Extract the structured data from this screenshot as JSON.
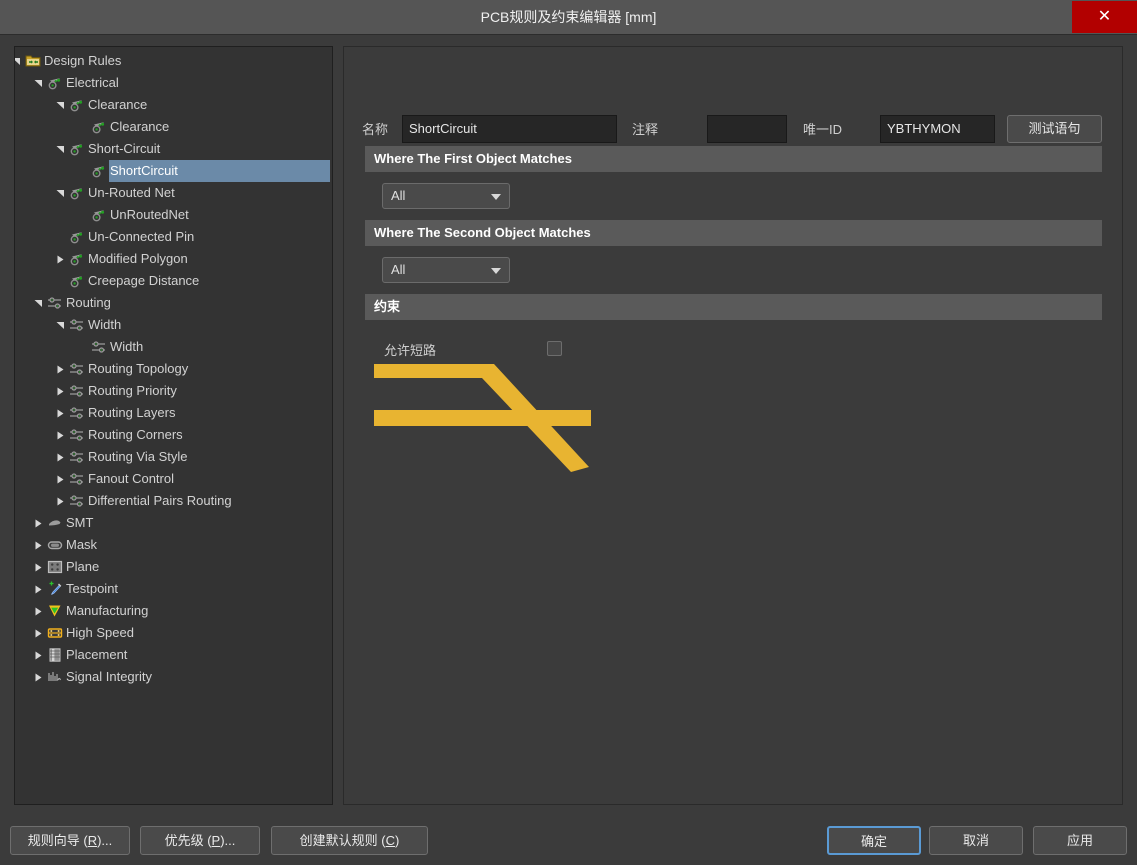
{
  "window": {
    "title": "PCB规则及约束编辑器 [mm]",
    "close_label": "✕",
    "accent_color": "#b20000",
    "selection_color": "#6b8aa8",
    "trace_color": "#e8b431"
  },
  "tree": {
    "root_label": "Design Rules",
    "items": [
      {
        "label": "Design Rules",
        "depth": 0,
        "icon": "design-rules-folder-icon",
        "arrow": "expanded",
        "selected": false
      },
      {
        "label": "Electrical",
        "depth": 1,
        "icon": "electrical-icon",
        "arrow": "expanded",
        "selected": false
      },
      {
        "label": "Clearance",
        "depth": 2,
        "icon": "electrical-icon",
        "arrow": "expanded",
        "selected": false
      },
      {
        "label": "Clearance",
        "depth": 3,
        "icon": "electrical-icon",
        "arrow": "none",
        "selected": false
      },
      {
        "label": "Short-Circuit",
        "depth": 2,
        "icon": "electrical-icon",
        "arrow": "expanded",
        "selected": false
      },
      {
        "label": "ShortCircuit",
        "depth": 3,
        "icon": "electrical-icon",
        "arrow": "none",
        "selected": true
      },
      {
        "label": "Un-Routed Net",
        "depth": 2,
        "icon": "electrical-icon",
        "arrow": "expanded",
        "selected": false
      },
      {
        "label": "UnRoutedNet",
        "depth": 3,
        "icon": "electrical-icon",
        "arrow": "none",
        "selected": false
      },
      {
        "label": "Un-Connected Pin",
        "depth": 2,
        "icon": "electrical-icon",
        "arrow": "none",
        "selected": false
      },
      {
        "label": "Modified Polygon",
        "depth": 2,
        "icon": "electrical-icon",
        "arrow": "collapsed",
        "selected": false
      },
      {
        "label": "Creepage Distance",
        "depth": 2,
        "icon": "electrical-icon",
        "arrow": "none",
        "selected": false
      },
      {
        "label": "Routing",
        "depth": 1,
        "icon": "routing-icon",
        "arrow": "expanded",
        "selected": false
      },
      {
        "label": "Width",
        "depth": 2,
        "icon": "routing-icon",
        "arrow": "expanded",
        "selected": false
      },
      {
        "label": "Width",
        "depth": 3,
        "icon": "routing-icon",
        "arrow": "none",
        "selected": false
      },
      {
        "label": "Routing Topology",
        "depth": 2,
        "icon": "routing-icon",
        "arrow": "collapsed",
        "selected": false
      },
      {
        "label": "Routing Priority",
        "depth": 2,
        "icon": "routing-icon",
        "arrow": "collapsed",
        "selected": false
      },
      {
        "label": "Routing Layers",
        "depth": 2,
        "icon": "routing-icon",
        "arrow": "collapsed",
        "selected": false
      },
      {
        "label": "Routing Corners",
        "depth": 2,
        "icon": "routing-icon",
        "arrow": "collapsed",
        "selected": false
      },
      {
        "label": "Routing Via Style",
        "depth": 2,
        "icon": "routing-icon",
        "arrow": "collapsed",
        "selected": false
      },
      {
        "label": "Fanout Control",
        "depth": 2,
        "icon": "routing-icon",
        "arrow": "collapsed",
        "selected": false
      },
      {
        "label": "Differential Pairs Routing",
        "depth": 2,
        "icon": "routing-icon",
        "arrow": "collapsed",
        "selected": false
      },
      {
        "label": "SMT",
        "depth": 1,
        "icon": "smt-icon",
        "arrow": "collapsed",
        "selected": false
      },
      {
        "label": "Mask",
        "depth": 1,
        "icon": "mask-icon",
        "arrow": "collapsed",
        "selected": false
      },
      {
        "label": "Plane",
        "depth": 1,
        "icon": "plane-icon",
        "arrow": "collapsed",
        "selected": false
      },
      {
        "label": "Testpoint",
        "depth": 1,
        "icon": "testpoint-icon",
        "arrow": "collapsed",
        "selected": false
      },
      {
        "label": "Manufacturing",
        "depth": 1,
        "icon": "manufacturing-icon",
        "arrow": "collapsed",
        "selected": false
      },
      {
        "label": "High Speed",
        "depth": 1,
        "icon": "high-speed-icon",
        "arrow": "collapsed",
        "selected": false
      },
      {
        "label": "Placement",
        "depth": 1,
        "icon": "placement-icon",
        "arrow": "collapsed",
        "selected": false
      },
      {
        "label": "Signal Integrity",
        "depth": 1,
        "icon": "signal-integrity-icon",
        "arrow": "collapsed",
        "selected": false
      }
    ]
  },
  "rule_form": {
    "name_label": "名称",
    "name_value": "ShortCircuit",
    "comment_label": "注释",
    "comment_value": "",
    "unique_id_label": "唯一ID",
    "unique_id_value": "YBTHYMON",
    "test_query_label": "测试语句",
    "first_object_header": "Where The First Object Matches",
    "first_object_scope": "All",
    "second_object_header": "Where The Second Object Matches",
    "second_object_scope": "All",
    "constraints_header": "约束",
    "allow_short_circuit_label": "允许短路",
    "allow_short_circuit_checked": false
  },
  "footer": {
    "rule_wizard": {
      "pre": "规则向导 (",
      "key": "R",
      "post": ")..."
    },
    "priority": {
      "pre": "优先级 (",
      "key": "P",
      "post": ")..."
    },
    "create_default_rules": {
      "pre": "创建默认规则 (",
      "key": "C",
      "post": ")"
    },
    "ok_label": "确定",
    "cancel_label": "取消",
    "apply_label": "应用"
  }
}
